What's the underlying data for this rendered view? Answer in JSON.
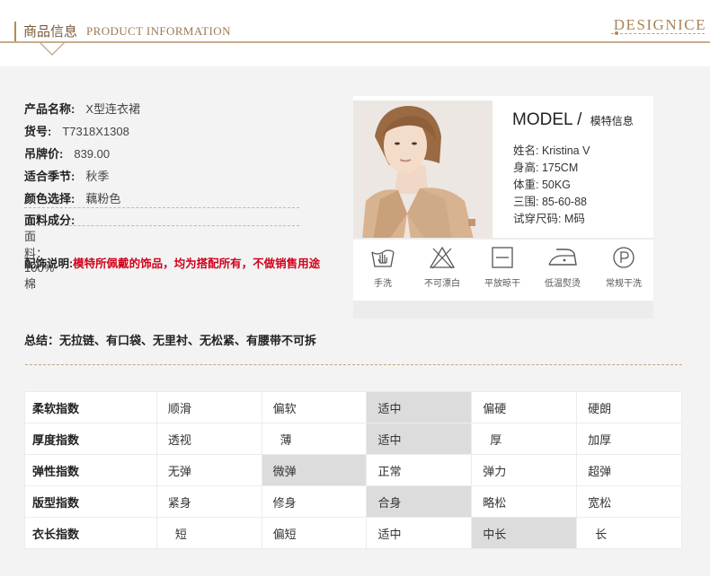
{
  "header": {
    "title_cn": "商品信息",
    "title_en": "PRODUCT INFORMATION",
    "brand": "DESIGNICE"
  },
  "product": {
    "name_label": "产品名称:",
    "name": "X型连衣裙",
    "sku_label": "货号:",
    "sku": "T7318X1308",
    "price_label": "吊牌价:",
    "price": "839.00",
    "season_label": "适合季节:",
    "season": "秋季",
    "color_label": "颜色选择:",
    "color": "藕粉色",
    "material_label": "面料成分:",
    "material": "面料：100%棉",
    "accessory_label": "配饰说明:",
    "accessory": "模特所佩戴的饰品，均为搭配所有，不做销售用途"
  },
  "model": {
    "title_en": "MODEL",
    "title_sep": "/",
    "title_cn": "模特信息",
    "lines": [
      "姓名: Kristina V",
      "身高: 175CM",
      "体重: 50KG",
      "三围: 85-60-88",
      "试穿尺码: M码"
    ]
  },
  "care": [
    {
      "icon": "hand-wash-icon",
      "label": "手洗"
    },
    {
      "icon": "no-bleach-icon",
      "label": "不可漂白"
    },
    {
      "icon": "dry-flat-icon",
      "label": "平放晾干"
    },
    {
      "icon": "low-iron-icon",
      "label": "低温熨烫"
    },
    {
      "icon": "dry-clean-icon",
      "label": "常规干洗"
    }
  ],
  "summary": "总结：无拉链、有口袋、无里衬、无松紧、有腰带不可拆",
  "index_table": [
    {
      "label": "柔软指数",
      "options": [
        "顺滑",
        "偏软",
        "适中",
        "偏硬",
        "硬朗"
      ],
      "selected": 2
    },
    {
      "label": "厚度指数",
      "options": [
        "透视",
        "薄",
        "适中",
        "厚",
        "加厚"
      ],
      "selected": 2
    },
    {
      "label": "弹性指数",
      "options": [
        "无弹",
        "微弹",
        "正常",
        "弹力",
        "超弹"
      ],
      "selected": 1
    },
    {
      "label": "版型指数",
      "options": [
        "紧身",
        "修身",
        "合身",
        "略松",
        "宽松"
      ],
      "selected": 2
    },
    {
      "label": "衣长指数",
      "options": [
        "短",
        "偏短",
        "适中",
        "中长",
        "长"
      ],
      "selected": 3
    }
  ],
  "colors": {
    "accent": "#b88a4c",
    "warning": "#d0021b",
    "selected_cell": "#dcdcdc"
  }
}
